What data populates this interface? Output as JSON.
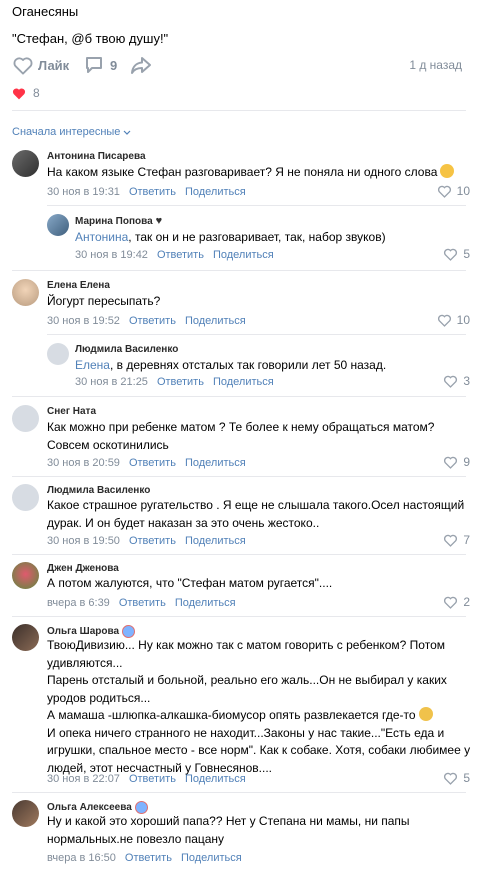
{
  "post": {
    "author": "Оганесяны",
    "text": "\"Стефан, @б твою душу!\"",
    "like_label": "Лайк",
    "comments_count": "9",
    "time": "1 д назад",
    "reactions_count": "8"
  },
  "sort_label": "Сначала интересные",
  "actions": {
    "reply": "Ответить",
    "share": "Поделиться"
  },
  "comments": [
    {
      "name": "Антонина Писарева",
      "lines": [
        "На каком языке Стефан разговаривает? Я не поняла ни одного слова"
      ],
      "time": "30 ноя в 19:31",
      "likes": "10"
    },
    {
      "name": "Марина Попова",
      "mention": "Антонина",
      "lines": [
        ", так он и не разговаривает, так, набор звуков)"
      ],
      "time": "30 ноя в 19:42",
      "likes": "5"
    },
    {
      "name": "Елена Елена",
      "lines": [
        "Йогурт пересыпать?"
      ],
      "time": "30 ноя в 19:52",
      "likes": "10"
    },
    {
      "name": "Людмила Василенко",
      "mention": "Елена",
      "lines": [
        ", в деревнях отсталых так говорили лет 50 назад."
      ],
      "time": "30 ноя в 21:25",
      "likes": "3"
    },
    {
      "name": "Снег Ната",
      "lines": [
        "Как можно при ребенке матом ? Те более к нему обращаться матом?",
        "Совсем оскотинились"
      ],
      "time": "30 ноя в 20:59",
      "likes": "9"
    },
    {
      "name": "Людмила Василенко",
      "lines": [
        "Какое страшное ругательство . Я еще не слышала такого.Осел настоящий",
        "дурак. И он будет наказан за это очень жестоко.."
      ],
      "time": "30 ноя в 19:50",
      "likes": "7"
    },
    {
      "name": "Джен Дженова",
      "lines": [
        "А потом жалуются, что \"Стефан матом ругается\"...."
      ],
      "time": "вчера в 6:39",
      "likes": "2"
    },
    {
      "name": "Ольга Шарова",
      "lines": [
        "ТвоюДивизию... Ну как можно так с матом говорить с ребенком? Потом",
        "удивляются...",
        "Парень отсталый и больной, реально его жаль...Он не выбирал у каких",
        "уродов родиться...",
        "А мамаша -шлюпка-алкашка-биомусор опять развлекается где-то",
        "И опека ничего странного не находит...Законы у нас такие...\"Есть еда и",
        "игрушки, спальное место - все норм\". Как к собаке. Хотя, собаки любимее у",
        "людей, этот несчастный у Говнесянов...."
      ],
      "time": "30 ноя в 22:07",
      "likes": "5"
    },
    {
      "name": "Ольга Алексеева",
      "lines": [
        "Ну и какой это хороший папа?? Нет у Степана ни мамы, ни папы",
        "нормальных.не повезло пацану"
      ],
      "time": "вчера в 16:50",
      "likes": ""
    }
  ],
  "colors": {
    "link": "#5181b8",
    "muted": "#818c99",
    "heart": "#ff3347"
  }
}
